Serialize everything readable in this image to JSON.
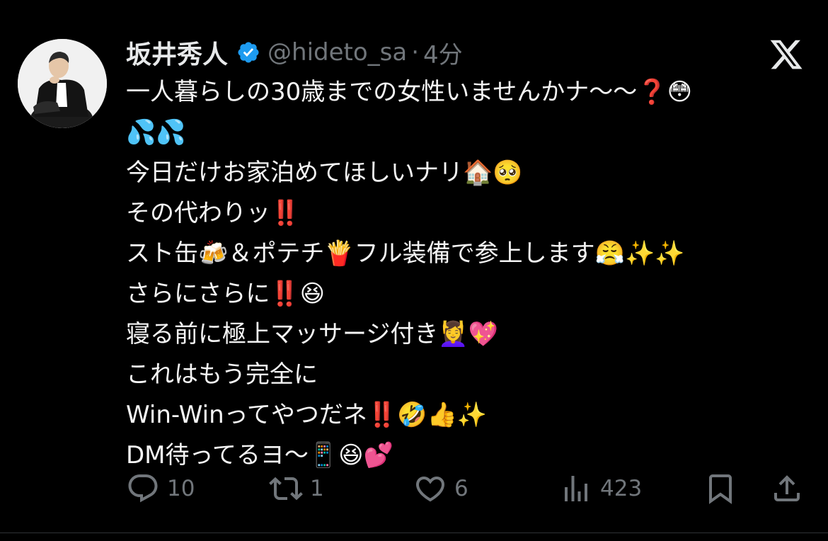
{
  "author": {
    "display_name": "坂井秀人",
    "handle": "@hideto_sa",
    "separator": "·",
    "time": "4分",
    "verified": true
  },
  "tweet_lines": [
    "一人暮らしの30歳までの女性いませんかナ〜〜❓😳",
    "💦💦",
    "今日だけお家泊めてほしいナリ🏠🥺",
    "その代わりッ‼️",
    "スト缶🍻＆ポテチ🍟フル装備で参上します😤✨✨",
    "さらにさらに‼️😆",
    "寝る前に極上マッサージ付き💆‍♀️💖",
    "これはもう完全に",
    "Win-Winってやつだネ‼️🤣👍✨",
    "DM待ってるヨ〜📱😆💕"
  ],
  "actions": {
    "reply_count": "10",
    "retweet_count": "1",
    "like_count": "6",
    "views_count": "423"
  },
  "icons": {
    "verified": "verified-badge-icon",
    "platform": "x-logo-icon",
    "reply": "reply-icon",
    "retweet": "retweet-icon",
    "like": "heart-icon",
    "views": "views-icon",
    "bookmark": "bookmark-icon",
    "share": "share-icon"
  },
  "colors": {
    "background": "#000000",
    "text_primary": "#e7e9ea",
    "text_secondary": "#71767b",
    "verified_blue": "#1d9bf0"
  }
}
